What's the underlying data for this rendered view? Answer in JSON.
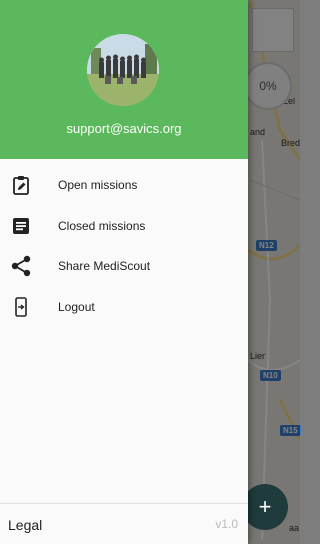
{
  "header": {
    "email": "support@savics.org",
    "color": "#5cb85c"
  },
  "menu": {
    "items": [
      {
        "label": "Open missions",
        "icon": "clipboard-edit-icon"
      },
      {
        "label": "Closed missions",
        "icon": "list-document-icon"
      },
      {
        "label": "Share MediScout",
        "icon": "share-icon"
      },
      {
        "label": "Logout",
        "icon": "logout-icon"
      }
    ]
  },
  "footer": {
    "legal_label": "Legal",
    "version": "v1.0"
  },
  "map": {
    "progress_label": "0%",
    "labels": [
      "Lel",
      "and",
      "Bred",
      "Lier",
      "aa"
    ],
    "roads": [
      "N12",
      "N10",
      "N15"
    ]
  }
}
